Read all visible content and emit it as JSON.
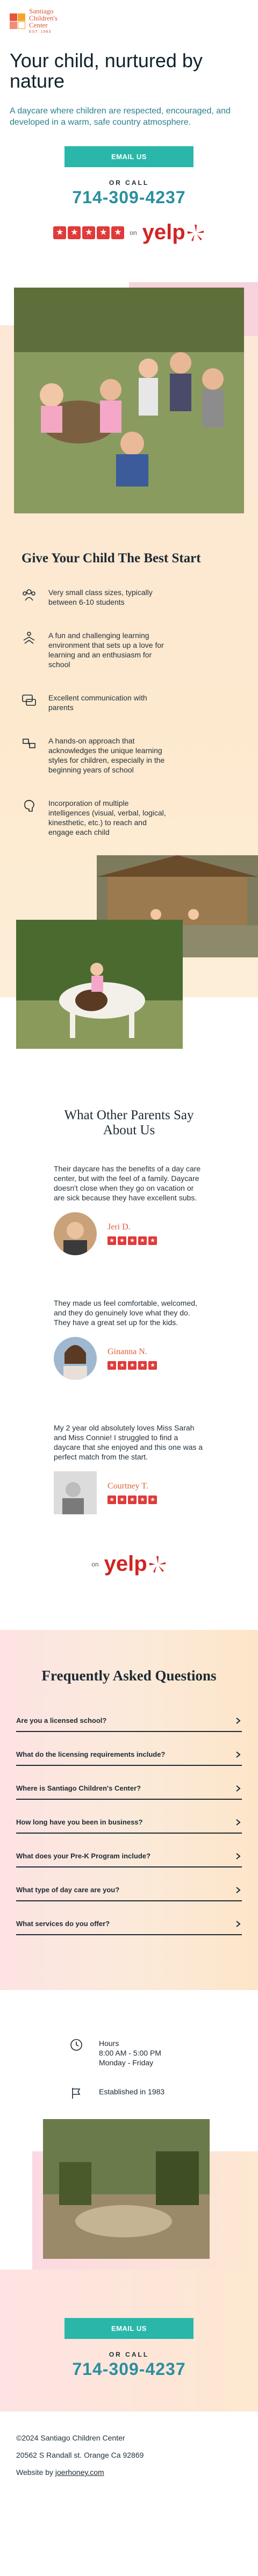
{
  "brand": {
    "name_line1": "Santiago",
    "name_line2": "Children's",
    "name_line3": "Center",
    "tagline": "EST. 1983",
    "colors": {
      "accent": "#2ab7a9",
      "phone": "#2a8fa0",
      "logo": "#d9533a",
      "yelp": "#d32323"
    }
  },
  "hero": {
    "title": "Your child, nurtured by nature",
    "subtitle": "A daycare where children are respected, encouraged, and developed in a warm, safe country atmosphere."
  },
  "cta": {
    "button": "EMAIL US",
    "oncall": "OR CALL",
    "phone": "714-309-4237"
  },
  "rating": {
    "on": "on",
    "brand": "yelp",
    "stars": 5
  },
  "best_start": {
    "title": "Give Your Child The Best Start",
    "features": [
      {
        "icon": "people-icon",
        "text": "Very small class sizes, typically between 6-10 students"
      },
      {
        "icon": "hands-icon",
        "text": "A fun and challenging learning environment that sets up a love for learning and an enthusiasm for school"
      },
      {
        "icon": "chat-icon",
        "text": "Excellent communication with parents"
      },
      {
        "icon": "handshake-icon",
        "text": "A hands-on approach that acknowledges the unique learning styles for children, especially in the beginning years of school"
      },
      {
        "icon": "brain-icon",
        "text": "Incorporation of multiple intelligences (visual, verbal, logical, kinesthetic, etc.) to reach and engage each child"
      }
    ]
  },
  "testimonials": {
    "title": "What Other Parents Say About Us",
    "items": [
      {
        "text": "Their daycare has the benefits of a day care center, but with the feel of a family. Daycare doesn't close when they go on vacation or are sick because they have excellent subs.",
        "name": "Jeri D."
      },
      {
        "text": "They made us feel comfortable, welcomed, and they do genuinely love what they do. They have a great set up for the kids.",
        "name": "Ginanna N."
      },
      {
        "text": "My 2 year old absolutely loves Miss Sarah and Miss Connie! I struggled to find a daycare that she enjoyed and this one was a perfect match from the start.",
        "name": "Courtney T."
      }
    ],
    "on": "on",
    "brand": "yelp"
  },
  "faq": {
    "title": "Frequently Asked Questions",
    "items": [
      "Are you a licensed school?",
      "What do the licensing requirements include?",
      "Where is Santiago Children's Center?",
      "How long have you been in business?",
      "What does your Pre-K Program include?",
      "What type of day care are you?",
      "What services do you offer?"
    ]
  },
  "info": {
    "hours_label": "Hours",
    "hours_time": "8:00 AM - 5:00 PM",
    "hours_days": "Monday - Friday",
    "established": "Established in 1983"
  },
  "footer": {
    "copyright": "©2024 Santiago Children Center",
    "address": "20562 S Randall st. Orange Ca 92869",
    "website_prefix": "Website by ",
    "website_link": "joerhoney.com"
  }
}
